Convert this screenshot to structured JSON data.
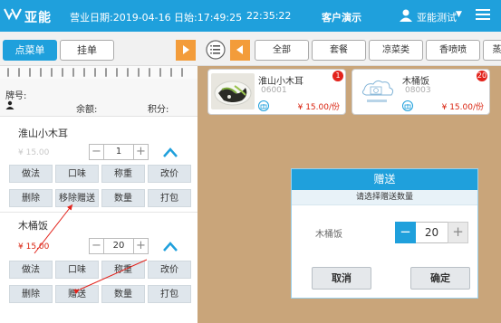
{
  "header": {
    "brand": "亚能",
    "business_date": "营业日期:2019-04-16",
    "day_time": "日始:17:49:25",
    "clock": "22:35:22",
    "client": "客户演示",
    "user": "亚能测试",
    "icons": [
      "logo-icon",
      "user-icon",
      "menu-icon"
    ]
  },
  "left_panel": {
    "tabs": [
      "点菜单",
      "挂单"
    ],
    "info": {
      "table_label": "牌号:",
      "balance_label": "余额:",
      "points_label": "积分:"
    },
    "items": [
      {
        "name": "淮山小木耳",
        "price": "¥ 15.00",
        "qty": "1",
        "actions": [
          "做法",
          "口味",
          "称重",
          "改价",
          "删除",
          "移除赠送",
          "数量",
          "打包"
        ]
      },
      {
        "name": "木桶饭",
        "price": "¥ 15.00",
        "qty": "20",
        "actions": [
          "做法",
          "口味",
          "称重",
          "改价",
          "删除",
          "赠送",
          "数量",
          "打包"
        ]
      }
    ]
  },
  "categories": [
    "全部",
    "套餐",
    "凉菜类",
    "香喷喷",
    "蒸"
  ],
  "products": [
    {
      "name": "淮山小木耳",
      "code": "06001",
      "price": "¥ 15.00/份",
      "badge": "1"
    },
    {
      "name": "木桶饭",
      "code": "08003",
      "price": "¥ 15.00/份",
      "badge": "20"
    }
  ],
  "dialog": {
    "title": "赠送",
    "subtitle": "请选择赠送数量",
    "item_name": "木桶饭",
    "qty": "20",
    "cancel": "取消",
    "confirm": "确定"
  },
  "colors": {
    "primary": "#1fa0dc",
    "accent": "#f39c3a",
    "price": "#d9230f",
    "badge": "#e3231c",
    "annotation": "#e3231c"
  }
}
